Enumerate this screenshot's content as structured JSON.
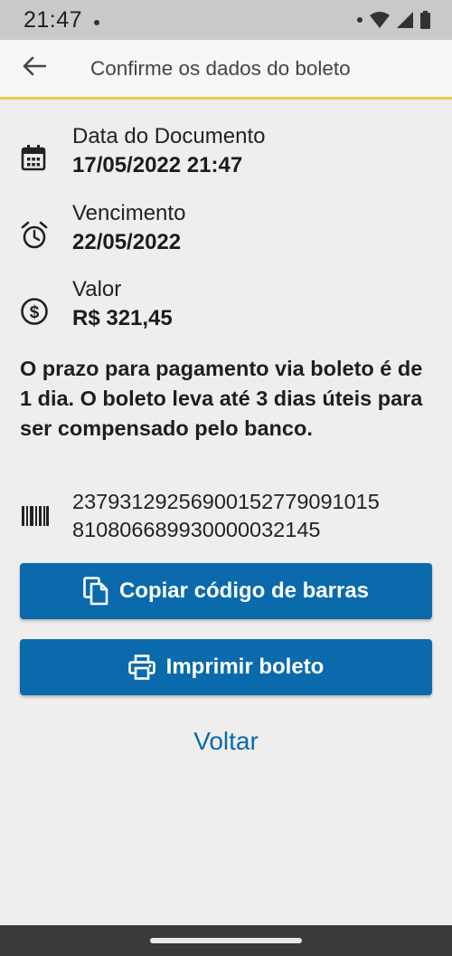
{
  "status_bar": {
    "time": "21:47"
  },
  "app_bar": {
    "title": "Confirme os dados do boleto"
  },
  "document_date": {
    "label": "Data do Documento",
    "value": "17/05/2022 21:47"
  },
  "due_date": {
    "label": "Vencimento",
    "value": "22/05/2022"
  },
  "amount": {
    "label": "Valor",
    "value": "R$ 321,45"
  },
  "notice": "O prazo para pagamento via boleto é de 1 dia. O boleto leva até 3 dias úteis para ser compensado pelo banco.",
  "barcode": {
    "line1": "23793129256900152779091015",
    "line2": "810806689930000032145"
  },
  "buttons": {
    "copy_label": "Copiar código de barras",
    "print_label": "Imprimir boleto"
  },
  "back_link": "Voltar",
  "colors": {
    "primary": "#0a6aac",
    "app_bar_accent": "#e7cf4a",
    "background": "#efeeec"
  }
}
